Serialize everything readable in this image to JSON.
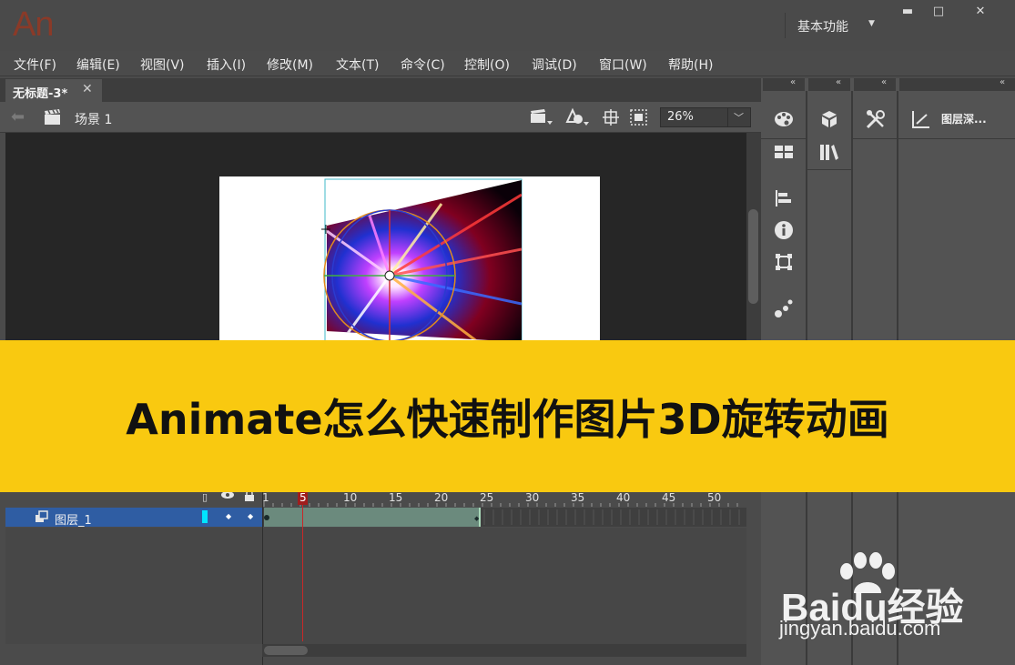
{
  "app": {
    "logo": "An"
  },
  "titlebar": {
    "workspace": "基本功能",
    "minimize": "▬",
    "restore": "□",
    "close": "✕"
  },
  "menu": [
    {
      "label": "文件(F)"
    },
    {
      "label": "编辑(E)"
    },
    {
      "label": "视图(V)"
    },
    {
      "label": "插入(I)"
    },
    {
      "label": "修改(M)"
    },
    {
      "label": "文本(T)"
    },
    {
      "label": "命令(C)"
    },
    {
      "label": "控制(O)"
    },
    {
      "label": "调试(D)"
    },
    {
      "label": "窗口(W)"
    },
    {
      "label": "帮助(H)"
    }
  ],
  "document": {
    "tab_label": "无标题-3*",
    "scene": "场景 1",
    "zoom": "26%"
  },
  "panels": {
    "layer_depth": "图层深..."
  },
  "timeline": {
    "ticks": [
      "1",
      "5",
      "10",
      "15",
      "20",
      "25",
      "30",
      "35",
      "40",
      "45",
      "50"
    ],
    "current_frame": "5",
    "layer_name": "图层_1"
  },
  "banner": {
    "title": "Animate怎么快速制作图片3D旋转动画"
  },
  "watermark": {
    "logo": "Baidu经验",
    "url": "jingyan.baidu.com"
  },
  "colors": {
    "banner": "#f9c910",
    "selected_layer": "#2f5da3",
    "playhead": "#c82828",
    "frames": "#6b8a7d"
  }
}
